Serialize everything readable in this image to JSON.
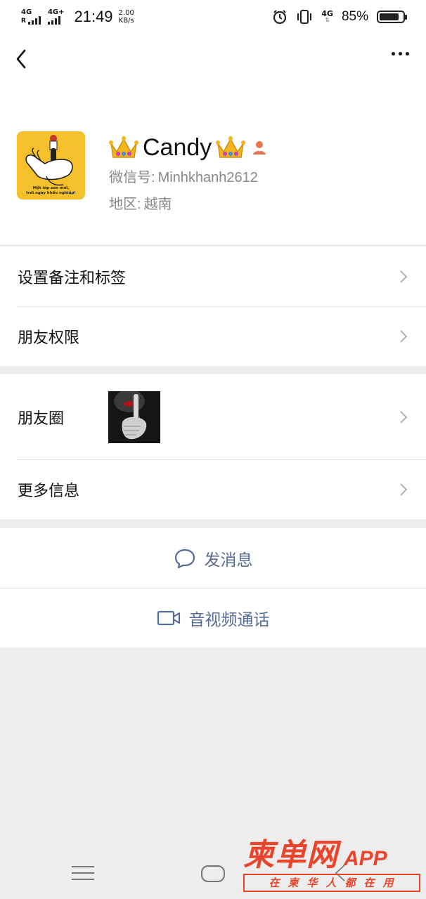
{
  "status_bar": {
    "network1": "4G",
    "network2": "4G+",
    "time": "21:49",
    "speed_value": "2.00",
    "speed_unit": "KB/s",
    "network3": "4G",
    "battery": "85%",
    "battery_level": 0.85
  },
  "profile": {
    "name": "Candy",
    "wechat_id_label": "微信号:",
    "wechat_id": "Minhkhanh2612",
    "region_label": "地区:",
    "region": "越南",
    "avatar_caption_line1": "Một lớp son mới,",
    "avatar_caption_line2": "trời ngay khẩu nghiệp!"
  },
  "list1": {
    "remarks": "设置备注和标签",
    "permissions": "朋友权限"
  },
  "list2": {
    "moments": "朋友圈",
    "more_info": "更多信息"
  },
  "actions": {
    "message": "发消息",
    "video_call": "音视频通话"
  },
  "watermark": {
    "title": "柬单网",
    "app": "APP",
    "subtitle": "在柬华人都在用"
  },
  "colors": {
    "link": "#576b95",
    "watermark": "#e8452c",
    "gender_icon": "#e9734f"
  }
}
